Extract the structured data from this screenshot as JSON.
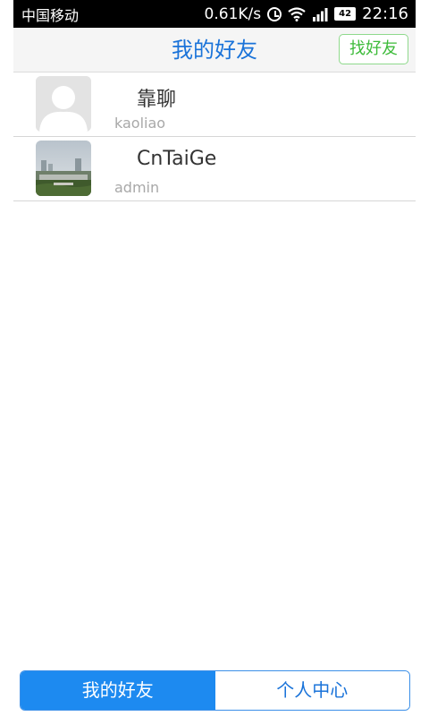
{
  "status_bar": {
    "carrier": "中国移动",
    "speed": "0.61K/s",
    "battery": "42",
    "time": "22:16",
    "icons": [
      "alarm-icon",
      "wifi-icon",
      "signal-icon",
      "battery-icon"
    ]
  },
  "header": {
    "title": "我的好友",
    "find_button_label": "找好友"
  },
  "friends": [
    {
      "name": "靠聊",
      "account": "kaoliao",
      "avatar": "default-avatar"
    },
    {
      "name": "CnTaiGe",
      "account": "admin",
      "avatar": "photo-avatar"
    }
  ],
  "tabs": [
    {
      "label": "我的好友",
      "active": true
    },
    {
      "label": "个人中心",
      "active": false
    }
  ],
  "colors": {
    "accent": "#1d8af0",
    "title": "#1a73d9",
    "find_button": "#3dbb3a",
    "status_bar": "#000000"
  }
}
